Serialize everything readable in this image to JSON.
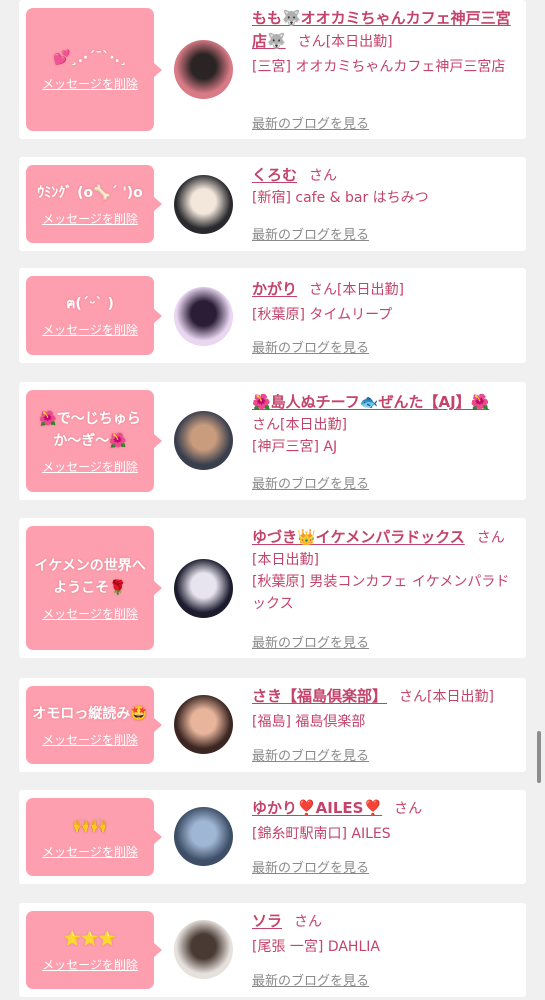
{
  "delete_label": "メッセージを削除",
  "blog_label": "最新のブログを見る",
  "san_label": "さん",
  "today_label": "[本日出勤]",
  "entries": [
    {
      "message": "💕¸.·´¯`·.¸",
      "name": "もも🐺オオカミちゃんカフェ神戸三宮店🐺",
      "today": true,
      "shop": "[三宮] オオカミちゃんカフェ神戸三宮店",
      "avatar_colors": [
        "#d97b86",
        "#2b2424"
      ]
    },
    {
      "message": "ｳﾐﾝｸﾞ (o🦴´ ')o",
      "name": "くろむ",
      "today": false,
      "shop": "[新宿] cafe & bar はちみつ",
      "avatar_colors": [
        "#2a2a2e",
        "#f3e7dc"
      ]
    },
    {
      "message": "ฅ(ˊᵕˋ )",
      "name": "かがり",
      "today": true,
      "shop": "[秋葉原] タイムリープ",
      "avatar_colors": [
        "#e9d6f1",
        "#2b1d35"
      ]
    },
    {
      "message": "🌺で〜じちゅらか〜ぎ〜🌺",
      "name": "🌺島人ぬチーフ🐟ぜんた【AJ】🌺",
      "today": true,
      "shop": "[神戸三宮] AJ",
      "avatar_colors": [
        "#3a3f4e",
        "#c99c7e"
      ]
    },
    {
      "message": "イケメンの世界へようこそ🌹",
      "name": "ゆづき👑イケメンパラドックス",
      "today": true,
      "shop": "[秋葉原] 男装コンカフェ イケメンパラドックス",
      "avatar_colors": [
        "#1c1c2e",
        "#e8e4ef"
      ]
    },
    {
      "message": "オモロっ縦読み🤩",
      "name": "さき【福島倶楽部】",
      "today": true,
      "shop": "[福島] 福島倶楽部",
      "avatar_colors": [
        "#3b2622",
        "#e8b49c"
      ]
    },
    {
      "message": "🙌🙌",
      "name": "ゆかり❣️AILES❣️",
      "today": false,
      "shop": "[錦糸町駅南口] AILES",
      "avatar_colors": [
        "#3d4e66",
        "#9fb6d4"
      ]
    },
    {
      "message": "⭐⭐⭐",
      "name": "ソラ",
      "today": false,
      "shop": "[尾張 一宮] DAHLIA",
      "avatar_colors": [
        "#e6e1dc",
        "#4a3a34"
      ]
    }
  ]
}
